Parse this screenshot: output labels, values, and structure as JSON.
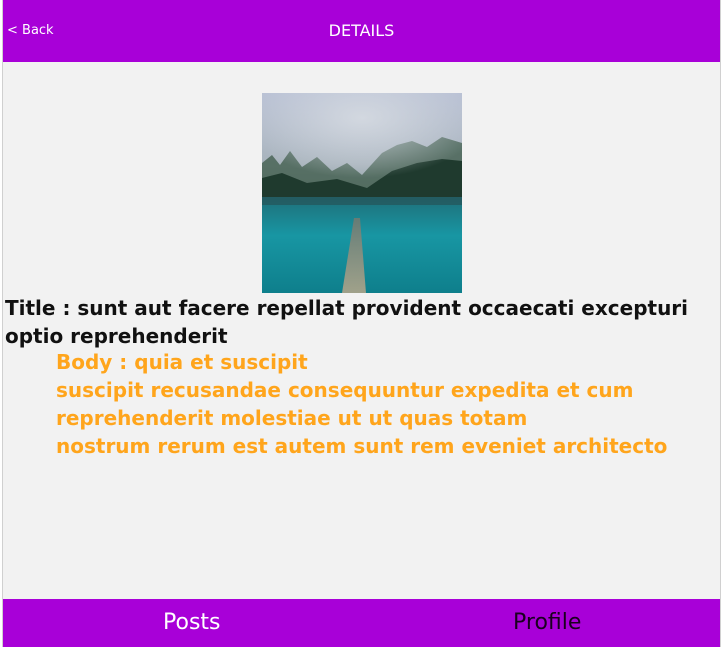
{
  "header": {
    "back_label": "< Back",
    "title": "DETAILS"
  },
  "post": {
    "image_icon": "misty-lake-photo",
    "title_text": "Title : sunt aut facere repellat provident occaecati excepturi optio reprehenderit",
    "body_lines": [
      "Body : quia et suscipit",
      "suscipit recusandae consequuntur expedita et cum",
      "reprehenderit molestiae ut ut quas totam",
      "nostrum rerum est autem sunt rem eveniet architecto"
    ]
  },
  "tabs": [
    {
      "label": "Posts",
      "active": true
    },
    {
      "label": "Profile",
      "active": false
    }
  ],
  "colors": {
    "primary": "#a800d8",
    "background": "#f2f2f2",
    "body_text": "#ffa51c",
    "title_text": "#111111",
    "active_tab_text": "#ffffff",
    "inactive_tab_text": "#1a001f"
  }
}
